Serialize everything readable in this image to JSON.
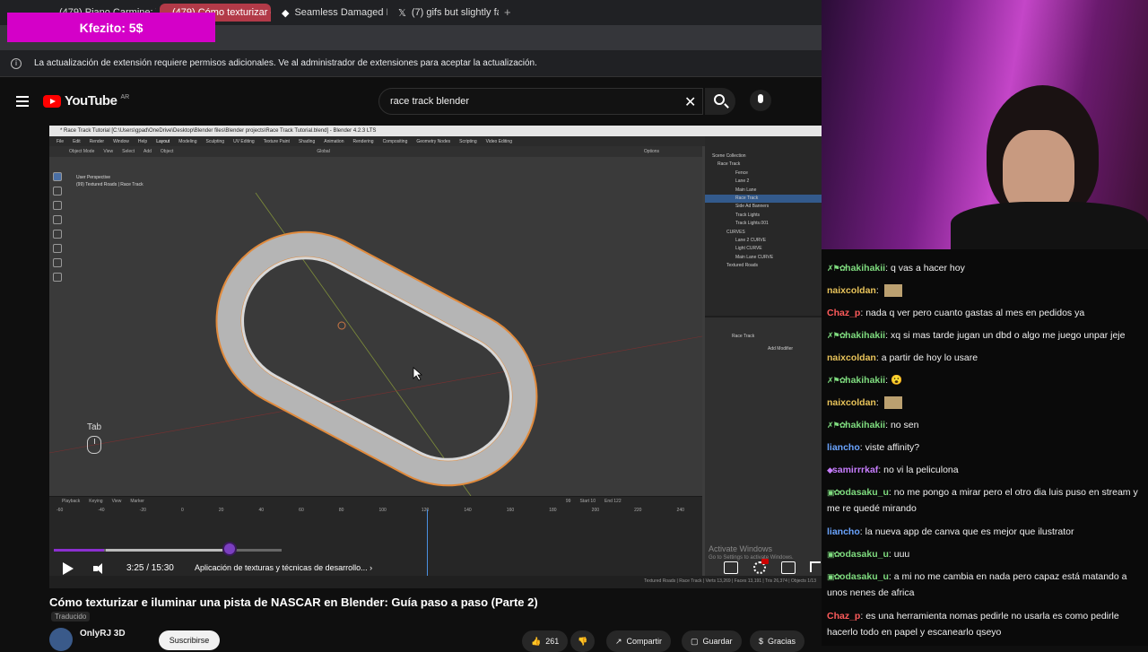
{
  "browser": {
    "tabs": [
      {
        "label": "(479) Piano Carmine: Ve"
      },
      {
        "label": "(479) Cómo texturizar e il"
      },
      {
        "label": "Seamless Damaged Road"
      },
      {
        "label": "(7) gifs but slightly faster e"
      }
    ],
    "new_tab": "+",
    "info": "La actualización de extensión requiere permisos adicionales. Ve al administrador de extensiones para aceptar la actualización."
  },
  "donation": "Kfezito: 5$",
  "youtube": {
    "logo": "YouTube",
    "country": "AR",
    "search_value": "race track blender"
  },
  "blender": {
    "title": "* Race Track Tutorial [C:\\Users\\gpad\\OneDrive\\Desktop\\Blender files\\Blender projects\\Race Track Tutorial.blend] - Blender 4.2.3 LTS",
    "menus": [
      "File",
      "Edit",
      "Render",
      "Window",
      "Help",
      "Layout",
      "Modeling",
      "Sculpting",
      "UV Editing",
      "Texture Paint",
      "Shading",
      "Animation",
      "Rendering",
      "Compositing",
      "Geometry Nodes",
      "Scripting",
      "Video Editing"
    ],
    "toolbar": [
      "Object Mode",
      "View",
      "Select",
      "Add",
      "Object",
      "Global",
      "Options"
    ],
    "viewport_label": "User Perspective\n(99) Textured Roads | Race Track",
    "outliner": [
      "Scene Collection",
      "Race Track",
      "Fence",
      "Lane 2",
      "Main Lane",
      "Race Track",
      "Side Ad Banners",
      "Track Lights",
      "Track Lights.001",
      "CURVES",
      "Lane 2 CURVE",
      "Light CURVE",
      "Main Lane CURVE",
      "Textured Roads"
    ],
    "props": {
      "object": "Race Track",
      "add_modifier": "Add Modifier"
    },
    "timeline_menu": [
      "Playback",
      "Keying",
      "View",
      "Marker"
    ],
    "timeline_ticks": [
      "-60",
      "-40",
      "-20",
      "0",
      "20",
      "40",
      "60",
      "80",
      "100",
      "120",
      "140",
      "160",
      "180",
      "200",
      "220",
      "240"
    ],
    "frame": "99",
    "start": "Start 10",
    "end": "End 122",
    "status": "Textured Roads | Race Track | Verts 13,269 | Faces 13,191 | Tris 26,374 | Objects 1/13"
  },
  "overlay_hint": {
    "key": "Tab"
  },
  "activate_windows": {
    "line1": "Activate Windows",
    "line2": "Go to Settings to activate Windows."
  },
  "player": {
    "time": "3:25 / 15:30",
    "chapter": "Aplicación de texturas y técnicas de desarrollo...",
    "progress": 0.22
  },
  "video": {
    "title": "Cómo texturizar e iluminar una pista de NASCAR en Blender: Guía paso a paso (Parte 2)",
    "translated": "Traducido",
    "channel": "OnlyRJ 3D",
    "subscribe": "Suscribirse",
    "likes": "261",
    "share": "Compartir",
    "save": "Guardar",
    "thanks": "Gracias"
  },
  "chat": [
    {
      "user": "hakihakii",
      "color": "#7fdc7f",
      "badges": "✗⚑✿",
      "text": "q vas a hacer hoy"
    },
    {
      "user": "naixcoldan",
      "color": "#e8c35a",
      "badges": "",
      "text": ""
    },
    {
      "user": "Chaz_p",
      "color": "#ff5b5b",
      "badges": "",
      "text": "nada q ver pero cuanto gastas al mes en pedidos ya"
    },
    {
      "user": "hakihakii",
      "color": "#7fdc7f",
      "badges": "✗⚑✿",
      "text": "xq si mas tarde jugan un dbd o algo me juego unpar jeje"
    },
    {
      "user": "naixcoldan",
      "color": "#e8c35a",
      "badges": "",
      "text": "a partir de hoy lo usare"
    },
    {
      "user": "hakihakii",
      "color": "#7fdc7f",
      "badges": "✗⚑✿",
      "text": "😮"
    },
    {
      "user": "naixcoldan",
      "color": "#e8c35a",
      "badges": "",
      "text": ""
    },
    {
      "user": "hakihakii",
      "color": "#7fdc7f",
      "badges": "✗⚑✿",
      "text": "no sen"
    },
    {
      "user": "liancho",
      "color": "#6aa4ff",
      "badges": "",
      "text": "viste affinity?"
    },
    {
      "user": "samirrrkaf",
      "color": "#c77dff",
      "badges": "◆",
      "text": "no vi la peliculona"
    },
    {
      "user": "odasaku_u",
      "color": "#7fdc7f",
      "badges": "▣✿",
      "text": "no me pongo a mirar pero el otro dia luis puso en stream y me re quedé mirando"
    },
    {
      "user": "liancho",
      "color": "#6aa4ff",
      "badges": "",
      "text": "la nueva app de canva que es mejor que ilustrator"
    },
    {
      "user": "odasaku_u",
      "color": "#7fdc7f",
      "badges": "▣✿",
      "text": "uuu"
    },
    {
      "user": "odasaku_u",
      "color": "#7fdc7f",
      "badges": "▣✿",
      "text": "a mi no me cambia en nada pero capaz está matando a unos nenes de africa"
    },
    {
      "user": "Chaz_p",
      "color": "#ff5b5b",
      "badges": "",
      "text": "es una herramienta nomas pedirle no usarla es como pedirle hacerlo todo en papel y escanearlo qseyo"
    }
  ]
}
